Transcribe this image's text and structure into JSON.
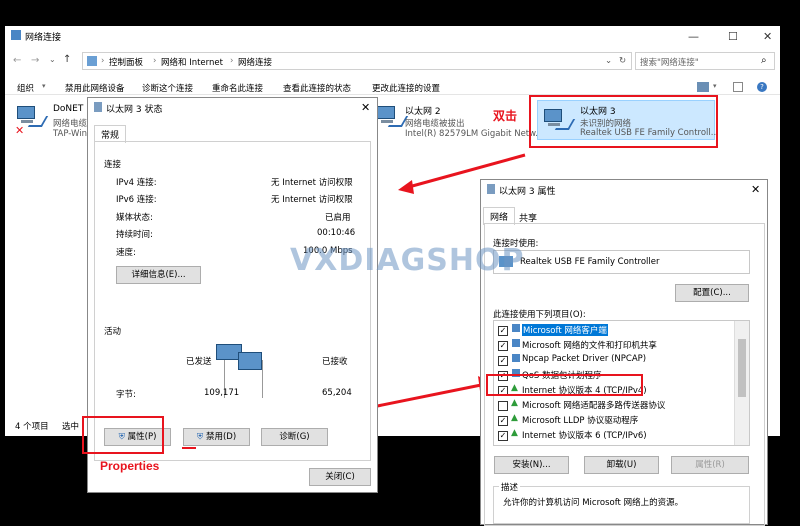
{
  "explorer": {
    "title": "网络连接",
    "breadcrumb": [
      "控制面板",
      "网络和 Internet",
      "网络连接"
    ],
    "search_placeholder": "搜索\"网络连接\"",
    "commands": [
      "组织",
      "禁用此网络设备",
      "诊断这个连接",
      "重命名此连接",
      "查看此连接的状态",
      "更改此连接的设置"
    ],
    "connections": [
      {
        "name": "DoNET",
        "status": "网络电缆",
        "adapter": "TAP-Win"
      },
      {
        "name": "以太网 2",
        "status": "网络电缆被拔出",
        "adapter": "Intel(R) 82579LM Gigabit Netw..."
      },
      {
        "name": "以太网 3",
        "status": "未识别的网络",
        "adapter": "Realtek USB FE Family Controll..."
      }
    ],
    "status_items": "4 个项目",
    "status_selected": "选中"
  },
  "status_dialog": {
    "title": "以太网 3 状态",
    "tab": "常规",
    "section_connection": "连接",
    "rows": [
      {
        "label": "IPv4 连接:",
        "value": "无 Internet 访问权限"
      },
      {
        "label": "IPv6 连接:",
        "value": "无 Internet 访问权限"
      },
      {
        "label": "媒体状态:",
        "value": "已启用"
      },
      {
        "label": "持续时间:",
        "value": "00:10:46"
      },
      {
        "label": "速度:",
        "value": "100.0 Mbps"
      }
    ],
    "details_button": "详细信息(E)...",
    "section_activity": "活动",
    "sent_label": "已发送",
    "received_label": "已接收",
    "bytes_label": "字节:",
    "bytes_sent": "109,171",
    "bytes_received": "65,204",
    "properties_button": "属性(P)",
    "disable_button": "禁用(D)",
    "diagnose_button": "诊断(G)",
    "close_button": "关闭(C)"
  },
  "props_dialog": {
    "title": "以太网 3 属性",
    "tabs": [
      "网络",
      "共享"
    ],
    "connect_using_label": "连接时使用:",
    "adapter": "Realtek USB FE Family Controller",
    "configure_button": "配置(C)...",
    "items_label": "此连接使用下列项目(O):",
    "items": [
      {
        "label": "Microsoft 网络客户端",
        "checked": true
      },
      {
        "label": "Microsoft 网络的文件和打印机共享",
        "checked": true
      },
      {
        "label": "Npcap Packet Driver (NPCAP)",
        "checked": true
      },
      {
        "label": "QoS 数据包计划程序",
        "checked": true
      },
      {
        "label": "Internet 协议版本 4 (TCP/IPv4)",
        "checked": true
      },
      {
        "label": "Microsoft 网络适配器多路传送器协议",
        "checked": false
      },
      {
        "label": "Microsoft LLDP 协议驱动程序",
        "checked": true
      },
      {
        "label": "Internet 协议版本 6 (TCP/IPv6)",
        "checked": true
      }
    ],
    "install_button": "安装(N)...",
    "uninstall_button": "卸载(U)",
    "properties_button": "属性(R)",
    "description_label": "描述",
    "description_text": "允许你的计算机访问 Microsoft 网络上的资源。"
  },
  "annotations": {
    "double_click": "双击",
    "properties": "Properties",
    "watermark": "VXDIAGSHOP"
  },
  "colors": {
    "annotation_red": "#e8141e",
    "selection_blue": "#cce8ff"
  }
}
